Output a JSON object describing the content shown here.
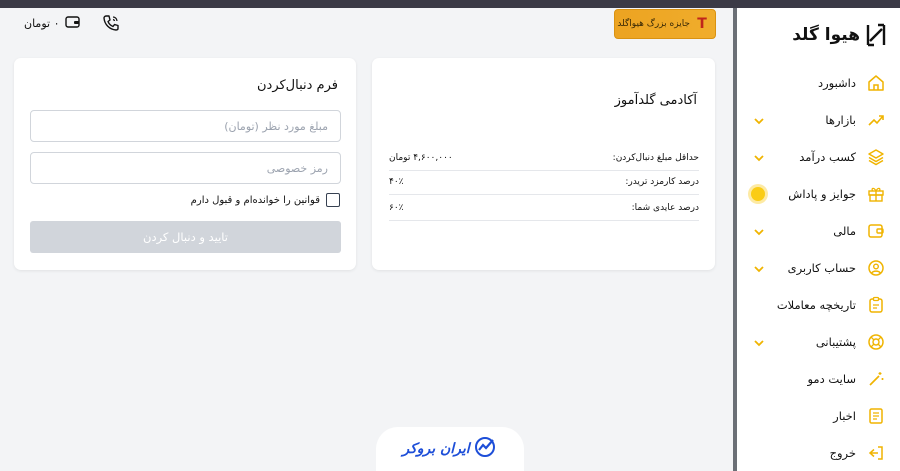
{
  "header": {
    "wallet_text": "۰ تومان",
    "prize_label": "جایزه بزرگ هیواگلد",
    "prize_badge": "T"
  },
  "sidebar": {
    "logo_text": "هیوا گلد",
    "items": [
      {
        "label": "داشبورد",
        "icon": "home-icon",
        "has_chevron": false
      },
      {
        "label": "بازارها",
        "icon": "trend-icon",
        "has_chevron": true
      },
      {
        "label": "کسب درآمد",
        "icon": "layers-icon",
        "has_chevron": true
      },
      {
        "label": "جوایز و پاداش",
        "icon": "gift-icon",
        "has_chevron": false,
        "has_dot": true
      },
      {
        "label": "مالی",
        "icon": "wallet-icon",
        "has_chevron": true
      },
      {
        "label": "حساب کاربری",
        "icon": "user-icon",
        "has_chevron": true
      },
      {
        "label": "تاریخچه معاملات",
        "icon": "clipboard-icon",
        "has_chevron": false
      },
      {
        "label": "پشتیبانی",
        "icon": "lifebuoy-icon",
        "has_chevron": true
      },
      {
        "label": "سایت دمو",
        "icon": "magic-wand-icon",
        "has_chevron": false
      },
      {
        "label": "اخبار",
        "icon": "newspaper-icon",
        "has_chevron": false
      },
      {
        "label": "خروج",
        "icon": "logout-icon",
        "has_chevron": false
      }
    ]
  },
  "academy": {
    "title": "آکادمی گلدآموز",
    "rows": [
      {
        "label": "حداقل مبلغ دنبال‌کردن:",
        "value": "۴,۶۰۰,۰۰۰ تومان"
      },
      {
        "label": "درصد کارمزد تریدر:",
        "value": "۴۰٪"
      },
      {
        "label": "درصد عایدی شما:",
        "value": "۶۰٪"
      }
    ]
  },
  "form": {
    "title": "فرم دنبال‌کردن",
    "amount_placeholder": "مبلغ مورد نظر (تومان)",
    "password_placeholder": "رمز خصوصی",
    "terms_label": "قوانین را خوانده‌ام و قبول دارم",
    "submit_label": "تایید و دنبال کردن"
  },
  "footer": {
    "brand_text": "ایران بروکر"
  },
  "colors": {
    "accent": "#facc15",
    "prize": "#f0ad2c",
    "brand": "#1d4ed8"
  }
}
